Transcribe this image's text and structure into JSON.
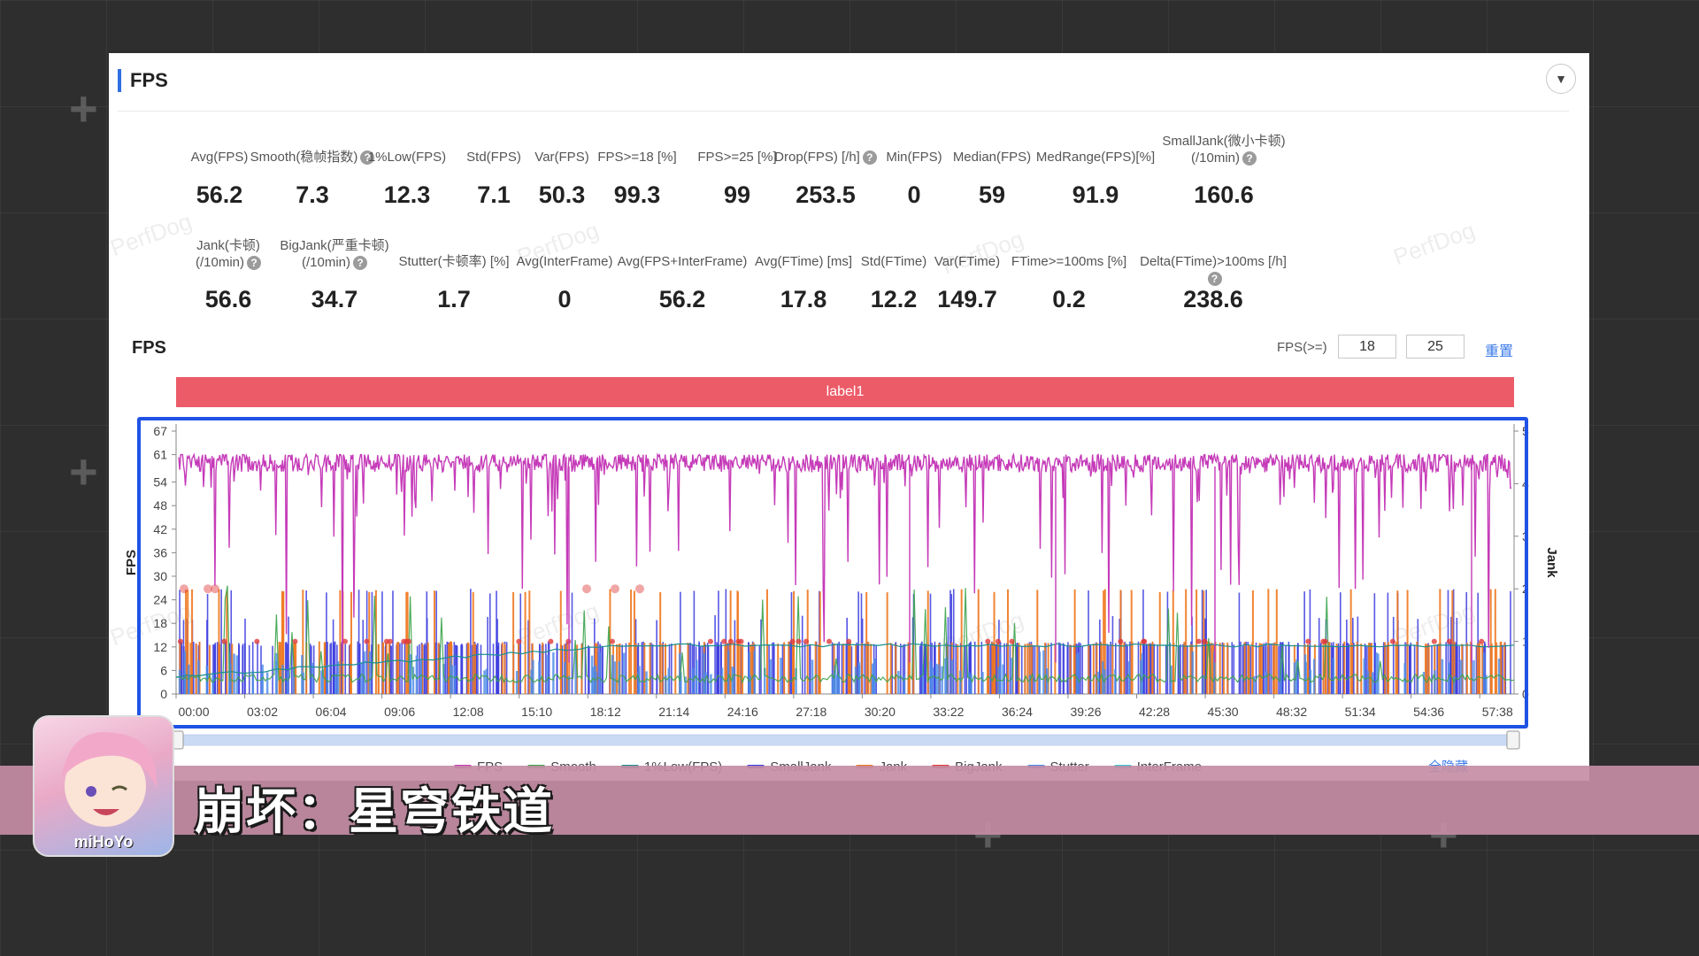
{
  "panel": {
    "title": "FPS",
    "collapse_icon": "chevron-down-icon"
  },
  "metrics_row1": [
    {
      "label": "Avg(FPS)",
      "value": "56.2",
      "help": false
    },
    {
      "label": "Smooth(稳帧指数)",
      "value": "7.3",
      "help": true
    },
    {
      "label": "1%Low(FPS)",
      "value": "12.3",
      "help": false
    },
    {
      "label": "Std(FPS)",
      "value": "7.1",
      "help": false
    },
    {
      "label": "Var(FPS)",
      "value": "50.3",
      "help": false
    },
    {
      "label": "FPS>=18 [%]",
      "value": "99.3",
      "help": false
    },
    {
      "label": "FPS>=25 [%]",
      "value": "99",
      "help": false
    },
    {
      "label": "Drop(FPS) [/h]",
      "value": "253.5",
      "help": true
    },
    {
      "label": "Min(FPS)",
      "value": "0",
      "help": false
    },
    {
      "label": "Median(FPS)",
      "value": "59",
      "help": false
    },
    {
      "label": "MedRange(FPS)[%]",
      "value": "91.9",
      "help": false
    },
    {
      "label": "SmallJank(微小卡顿)",
      "label2": "(/10min)",
      "value": "160.6",
      "help": true
    }
  ],
  "metrics_row2": [
    {
      "label": "Jank(卡顿)",
      "label2": "(/10min)",
      "value": "56.6",
      "help": true
    },
    {
      "label": "BigJank(严重卡顿)",
      "label2": "(/10min)",
      "value": "34.7",
      "help": true
    },
    {
      "label": "Stutter(卡顿率) [%]",
      "value": "1.7",
      "help": false
    },
    {
      "label": "Avg(InterFrame)",
      "value": "0",
      "help": false
    },
    {
      "label": "Avg(FPS+InterFrame)",
      "value": "56.2",
      "help": false
    },
    {
      "label": "Avg(FTime) [ms]",
      "value": "17.8",
      "help": false
    },
    {
      "label": "Std(FTime)",
      "value": "12.2",
      "help": false
    },
    {
      "label": "Var(FTime)",
      "value": "149.7",
      "help": false
    },
    {
      "label": "FTime>=100ms [%]",
      "value": "0.2",
      "help": false
    },
    {
      "label": "Delta(FTime)>100ms [/h]",
      "value": "238.6",
      "help": true
    }
  ],
  "watermark": "PerfDog",
  "chart_section": {
    "title": "FPS",
    "filter_label": "FPS(>=)",
    "filter_value_1": "18",
    "filter_value_2": "25",
    "reset_label": "重置",
    "label_bar": "label1",
    "show_all_label": "全隐藏"
  },
  "chart_data": {
    "type": "line",
    "ylabel": "FPS",
    "y2label": "Jank",
    "ylim": [
      0,
      67
    ],
    "y_ticks": [
      0,
      6,
      12,
      18,
      24,
      30,
      36,
      42,
      48,
      54,
      61,
      67
    ],
    "y2lim": [
      0,
      5
    ],
    "y2_ticks": [
      0,
      1,
      2,
      3,
      4,
      5
    ],
    "x_ticks": [
      "00:00",
      "03:02",
      "06:04",
      "09:06",
      "12:08",
      "15:10",
      "18:12",
      "21:14",
      "24:16",
      "27:18",
      "30:20",
      "33:22",
      "36:24",
      "39:26",
      "42:28",
      "45:30",
      "48:32",
      "51:34",
      "54:36",
      "57:38"
    ],
    "duration_min": 60,
    "fps_typical": 59,
    "legend": [
      {
        "name": "FPS",
        "color": "#c53ab8"
      },
      {
        "name": "Smooth",
        "color": "#3aa34a"
      },
      {
        "name": "1%Low(FPS)",
        "color": "#1a8f8f"
      },
      {
        "name": "SmallJank",
        "color": "#3a3ae0"
      },
      {
        "name": "Jank",
        "color": "#f07820"
      },
      {
        "name": "BigJank",
        "color": "#e03a3a"
      },
      {
        "name": "Stutter",
        "color": "#4a8ae8"
      },
      {
        "name": "InterFrame",
        "color": "#3ac8d8"
      }
    ],
    "series_colors": {
      "fps": "#c53ab8",
      "smooth": "#3aa34a",
      "low": "#1a8f8f",
      "smalljank": "#3a3ae0",
      "jank": "#f07820",
      "bigjank": "#e03a3a",
      "stutter": "#4a8ae8"
    }
  },
  "banner": {
    "game_title": "崩坏：星穹铁道",
    "brand": "miHoYo"
  }
}
